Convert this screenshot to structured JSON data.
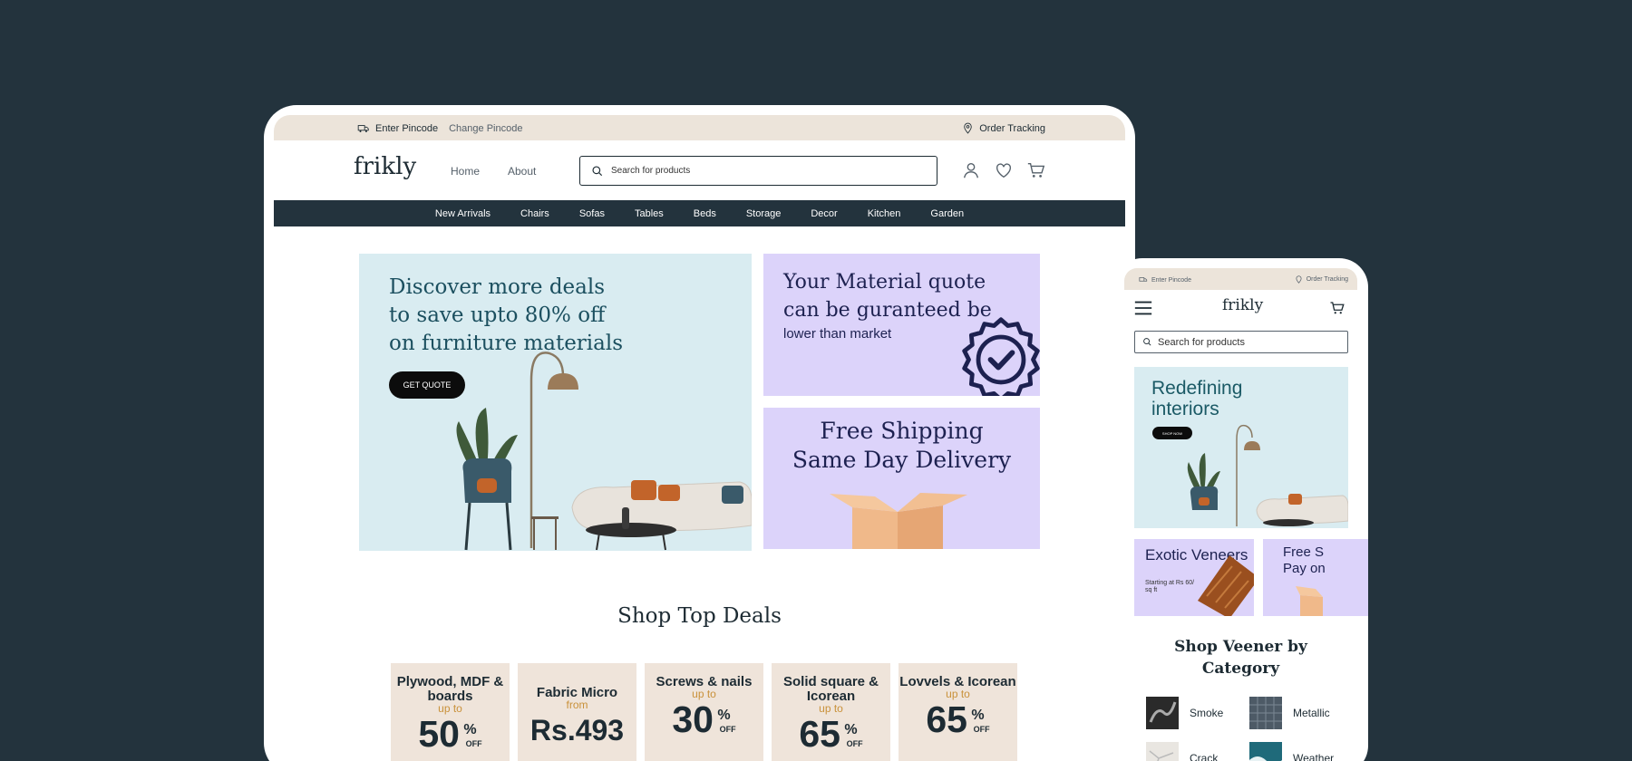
{
  "desktop": {
    "topbar": {
      "pincode": "Enter Pincode",
      "change": "Change Pincode",
      "tracking": "Order Tracking"
    },
    "logo": "frikly",
    "nav": [
      "Home",
      "About"
    ],
    "search_placeholder": "Search for products",
    "categories": [
      "New Arrivals",
      "Chairs",
      "Sofas",
      "Tables",
      "Beds",
      "Storage",
      "Decor",
      "Kitchen",
      "Garden"
    ],
    "hero_main": {
      "title": "Discover more deals to save upto 80% off on furniture materials",
      "button": "GET QUOTE"
    },
    "hero_quote": {
      "title_line1": "Your Material quote",
      "title_line2": "can be guranteed be",
      "subtitle": "lower than market"
    },
    "hero_shipping": {
      "line1": "Free Shipping",
      "line2": "Same Day Delivery"
    },
    "shop_title": "Shop Top Deals",
    "deals": [
      {
        "title": "Plywood, MDF & boards",
        "prefix": "up to",
        "value": "50",
        "unit": "%",
        "suffix": "OFF"
      },
      {
        "title": "Fabric Micro",
        "prefix": "from",
        "value": "Rs.493",
        "unit": "",
        "suffix": ""
      },
      {
        "title": "Screws & nails",
        "prefix": "up to",
        "value": "30",
        "unit": "%",
        "suffix": "OFF"
      },
      {
        "title": "Solid square & Icorean",
        "prefix": "up to",
        "value": "65",
        "unit": "%",
        "suffix": "OFF"
      },
      {
        "title": "Lovvels & Icorean",
        "prefix": "up to",
        "value": "65",
        "unit": "%",
        "suffix": "OFF"
      }
    ]
  },
  "mobile": {
    "topbar": {
      "pincode": "Enter Pincode",
      "tracking": "Order Tracking"
    },
    "logo": "frikly",
    "search_placeholder": "Search for products",
    "hero": {
      "title": "Redefining interiors",
      "button": "SHOP NOW"
    },
    "card1": {
      "title": "Exotic Veneers",
      "subtitle": "Starting at Rs 60/ sq ft"
    },
    "card2": {
      "line1": "Free S",
      "line2": "Pay on"
    },
    "category_title": "Shop Veener by Category",
    "categories": [
      "Smoke",
      "Metallic",
      "Crack",
      "Weather"
    ]
  },
  "colors": {
    "background": "#23333d",
    "topbar": "#ece4da",
    "mint": "#d9ecf1",
    "lavender": "#dcd3fa",
    "navy": "#1d2150"
  }
}
